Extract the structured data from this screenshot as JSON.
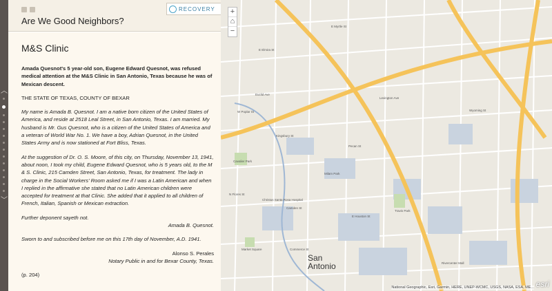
{
  "header": {
    "title": "Are We Good Neighbors?",
    "logo_text": "RECOVERY",
    "share_icons": [
      "facebook-icon",
      "twitter-icon"
    ]
  },
  "section": {
    "heading": "M&S Clinic",
    "lead": "Amada Quesnot's 5 year-old son, Eugene Edward Quesnot, was refused medical attention at the M&S Clinic in San Antonio, Texas because he was of Mexican descent.",
    "state_line": "THE STATE OF TEXAS, COUNTY OF BEXAR",
    "para1": "My name is Amada B. Quesnot. I am a native born citizen of the United States of America, and reside at 2518 Leal Street, in San Antonio, Texas. I am married. My husband is Mr. Gus Quesnot, who is a citizen of the United States of America and a veteran of World War No. 1. We have a boy, Adrian Quesnot, in the United States Army and is now stationed at Fort Bliss, Texas.",
    "para2": "At the suggestion of Dr. O. S. Moore, of this city, on Thursday, November 13, 1941, about noon, I took my child, Eugene Edward Quesnot, who is 5 years old, to the M & S. Clinic, 215 Camden Street, San Antonio, Texas, for treatment. The lady in charge in the Social Workers' Room asked me if I was a Latin American and when I replied in the affirmative she stated that no Latin American children were accepted for treatment at that Clinic. She added that it applied to all children of French, Italian, Spanish or Mexican extraction.",
    "deponent": "Further deponent sayeth not.",
    "signature": "Amada B. Quesnot.",
    "sworn": "Sworn to and subscribed before me on this 17th day of November, A.D. 1941.",
    "notary_name": "Alonso S. Perales",
    "notary_title": "Notary Public in and for Bexar County, Texas.",
    "page_ref": "(p. 204)"
  },
  "map": {
    "city_label_1": "San",
    "city_label_2": "Antonio",
    "attribution": "National Geographic, Esri, Garmin, HERE, UNEP-WCMC, USGS, NASA, ESA, ME...",
    "esri_logo": "esri",
    "zoom_in": "+",
    "home": "⌂",
    "zoom_out": "−",
    "street_labels": [
      "E Elmira St",
      "E Myrtle St",
      "Kingsbury St",
      "Euclid Ave",
      "N Flores St",
      "W Poplar St",
      "Wyoming St",
      "Market Square",
      "Milam Park",
      "Travis Park",
      "E Houston St",
      "Commerce St",
      "Pecan St",
      "Lexington Ave",
      "Camden St",
      "Rivercenter Mall",
      "Christus Santa Rosa Hospital",
      "Cavalier Park"
    ]
  },
  "nav": {
    "up_icon": "chevron-up-icon",
    "down_icon": "chevron-down-icon"
  }
}
